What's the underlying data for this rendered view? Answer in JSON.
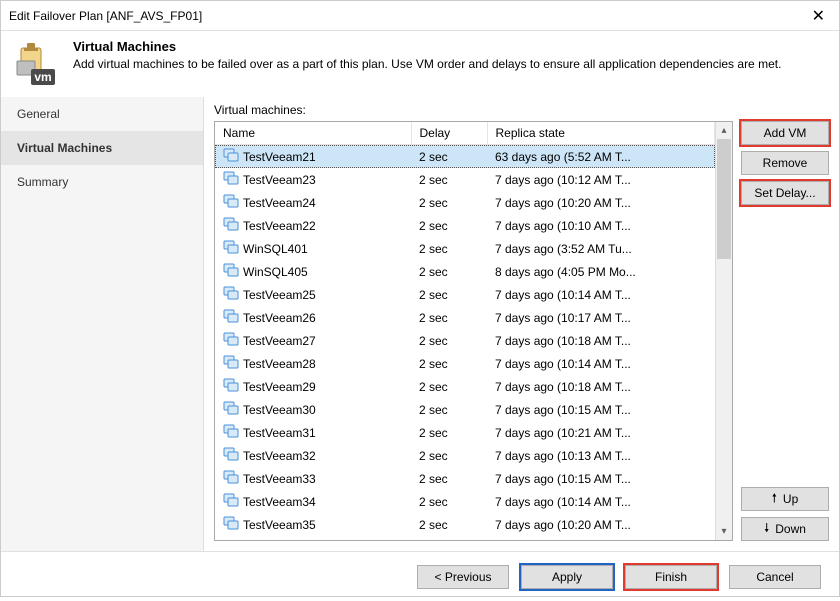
{
  "titlebar": {
    "title": "Edit Failover Plan [ANF_AVS_FP01]"
  },
  "header": {
    "title": "Virtual Machines",
    "desc": "Add virtual machines to be failed over as a part of this plan. Use VM order and delays to ensure all application dependencies are met."
  },
  "sidebar": {
    "items": [
      "General",
      "Virtual Machines",
      "Summary"
    ],
    "active_index": 1
  },
  "main": {
    "label": "Virtual machines:",
    "columns": {
      "name": "Name",
      "delay": "Delay",
      "state": "Replica state"
    },
    "rows": [
      {
        "name": "TestVeeam21",
        "delay": "2 sec",
        "state": "63 days ago (5:52 AM T...",
        "selected": true
      },
      {
        "name": "TestVeeam23",
        "delay": "2 sec",
        "state": "7 days ago (10:12 AM T..."
      },
      {
        "name": "TestVeeam24",
        "delay": "2 sec",
        "state": "7 days ago (10:20 AM T..."
      },
      {
        "name": "TestVeeam22",
        "delay": "2 sec",
        "state": "7 days ago (10:10 AM T..."
      },
      {
        "name": "WinSQL401",
        "delay": "2 sec",
        "state": "7 days ago (3:52 AM Tu..."
      },
      {
        "name": "WinSQL405",
        "delay": "2 sec",
        "state": "8 days ago (4:05 PM Mo..."
      },
      {
        "name": "TestVeeam25",
        "delay": "2 sec",
        "state": "7 days ago (10:14 AM T..."
      },
      {
        "name": "TestVeeam26",
        "delay": "2 sec",
        "state": "7 days ago (10:17 AM T..."
      },
      {
        "name": "TestVeeam27",
        "delay": "2 sec",
        "state": "7 days ago (10:18 AM T..."
      },
      {
        "name": "TestVeeam28",
        "delay": "2 sec",
        "state": "7 days ago (10:14 AM T..."
      },
      {
        "name": "TestVeeam29",
        "delay": "2 sec",
        "state": "7 days ago (10:18 AM T..."
      },
      {
        "name": "TestVeeam30",
        "delay": "2 sec",
        "state": "7 days ago (10:15 AM T..."
      },
      {
        "name": "TestVeeam31",
        "delay": "2 sec",
        "state": "7 days ago (10:21 AM T..."
      },
      {
        "name": "TestVeeam32",
        "delay": "2 sec",
        "state": "7 days ago (10:13 AM T..."
      },
      {
        "name": "TestVeeam33",
        "delay": "2 sec",
        "state": "7 days ago (10:15 AM T..."
      },
      {
        "name": "TestVeeam34",
        "delay": "2 sec",
        "state": "7 days ago (10:14 AM T..."
      },
      {
        "name": "TestVeeam35",
        "delay": "2 sec",
        "state": "7 days ago (10:20 AM T..."
      }
    ],
    "buttons": {
      "add": "Add VM",
      "remove": "Remove",
      "set_delay": "Set Delay...",
      "up": "Up",
      "down": "Down"
    }
  },
  "footer": {
    "previous": "< Previous",
    "apply": "Apply",
    "finish": "Finish",
    "cancel": "Cancel"
  }
}
